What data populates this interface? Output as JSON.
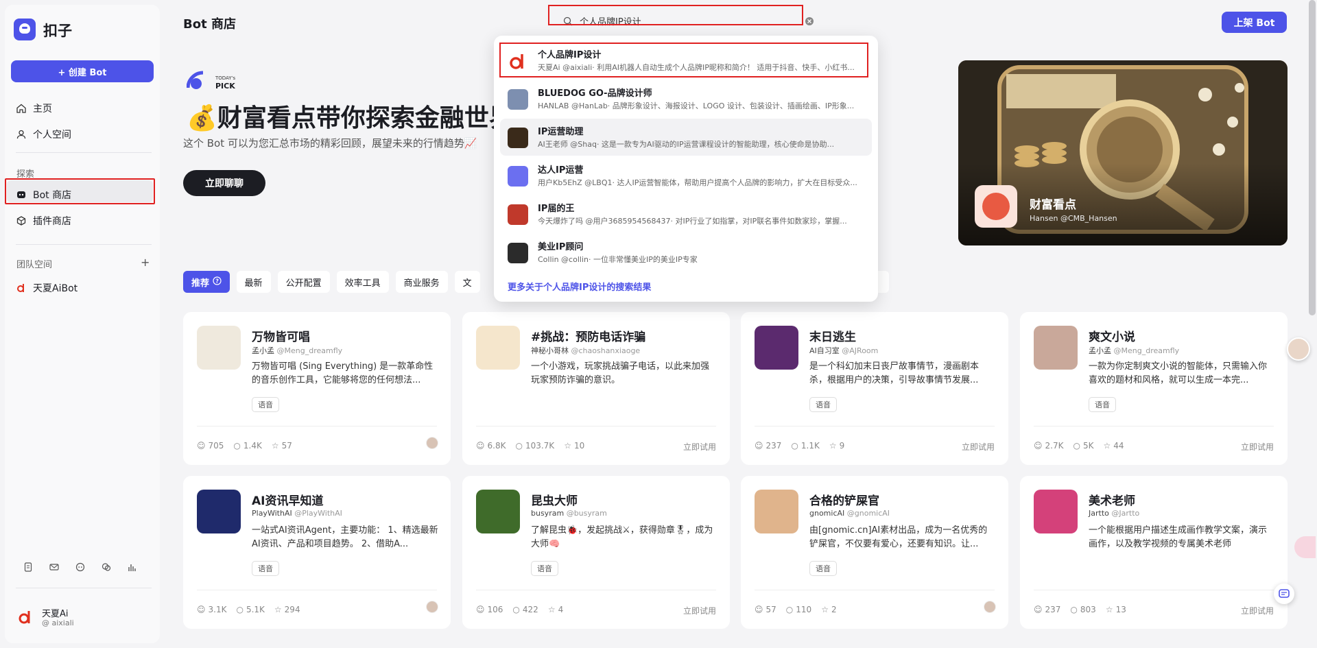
{
  "app": {
    "brand": "扣子"
  },
  "sidebar": {
    "create_label": "+ 创建 Bot",
    "items": [
      {
        "label": "主页",
        "icon": "home-icon"
      },
      {
        "label": "个人空间",
        "icon": "user-icon"
      }
    ],
    "explore_title": "探索",
    "explore_items": [
      {
        "label": "Bot 商店",
        "icon": "bot-store-icon",
        "active": true
      },
      {
        "label": "插件商店",
        "icon": "plugin-icon"
      }
    ],
    "team_title": "团队空间",
    "team_items": [
      {
        "label": "天夏AiBot"
      }
    ],
    "user": {
      "name": "天夏Ai",
      "handle": "@ aixiali"
    }
  },
  "header": {
    "title": "Bot 商店",
    "upload_label": "上架 Bot"
  },
  "search": {
    "value": "个人品牌IP设计"
  },
  "dropdown": {
    "items": [
      {
        "name": "个人品牌IP设计",
        "desc": "天夏Ai @aixiali· 利用AI机器人自动生成个人品牌IP昵称和简介！ 适用于抖音、快手、小红书...",
        "color": "#ffffff"
      },
      {
        "name": "BLUEDOG GO-品牌设计师",
        "desc": "HANLAB @HanLab· 品牌形象设计、海报设计、LOGO 设计、包装设计、插画绘画、IP形象...",
        "color": "#7d8fb0"
      },
      {
        "name": "IP运营助理",
        "desc": "AI王老师 @Shaq· 这是一款专为AI驱动的IP运营课程设计的智能助理，核心使命是协助...",
        "color": "#3a2a1a"
      },
      {
        "name": "达人IP运营",
        "desc": "用户Kb5EhZ @LBQ1· 达人IP运营智能体，帮助用户提高个人品牌的影响力，扩大在目标受众...",
        "color": "#6b6ff0"
      },
      {
        "name": "IP届的王",
        "desc": "今天爆炸了吗 @用户3685954568437· 对IP行业了如指掌，对IP联名事件如数家珍，掌握...",
        "color": "#c0392b"
      },
      {
        "name": "美业IP顾问",
        "desc": "Collin @collin· 一位非常懂美业IP的美业IP专家",
        "color": "#2b2b2b"
      }
    ],
    "more": "更多关于个人品牌IP设计的搜索结果"
  },
  "hero": {
    "pick": "TODAY'S PICK",
    "title": "💰财富看点带你探索金融世界",
    "desc": "这个 Bot 可以为您汇总市场的精彩回顾，展望未来的行情趋势📈",
    "button": "立即聊聊",
    "card_name": "财富看点",
    "card_author": "Hansen @CMB_Hansen"
  },
  "tabs": [
    "推荐",
    "最新",
    "公开配置",
    "效率工具",
    "商业服务",
    "文"
  ],
  "cards": [
    {
      "title": "万物皆可唱",
      "author": "孟小孟",
      "handle": "@Meng_dreamfly",
      "desc": "万物皆可唱 (Sing Everything) 是一款革命性的音乐创作工具，它能够将您的任何想法...",
      "tag": "语音",
      "users": "705",
      "chats": "1.4K",
      "stars": "57",
      "try": "",
      "thumb": "#efe9dd"
    },
    {
      "title": "#挑战：预防电话诈骗",
      "author": "神秘小哥林",
      "handle": "@chaoshanxiaoge",
      "desc": "一个小游戏，玩家挑战骗子电话，以此来加强玩家预防诈骗的意识。",
      "tag": "",
      "users": "6.8K",
      "chats": "103.7K",
      "stars": "10",
      "try": "立即试用",
      "thumb": "#f5e6cc"
    },
    {
      "title": "末日逃生",
      "author": "AI自习室",
      "handle": "@AJRoom",
      "desc": "是一个科幻加末日丧尸故事情节，漫画剧本杀，根据用户的决策，引导故事情节发展...",
      "tag": "语音",
      "users": "237",
      "chats": "1.1K",
      "stars": "9",
      "try": "立即试用",
      "thumb": "#5b2a6e"
    },
    {
      "title": "爽文小说",
      "author": "孟小孟",
      "handle": "@Meng_dreamfly",
      "desc": "一款为你定制爽文小说的智能体，只需输入你喜欢的题材和风格，就可以生成一本完...",
      "tag": "语音",
      "users": "2.7K",
      "chats": "5K",
      "stars": "44",
      "try": "立即试用",
      "thumb": "#c9a89a"
    },
    {
      "title": "AI资讯早知道",
      "author": "PlayWithAI",
      "handle": "@PlayWithAI",
      "desc": "一站式AI资讯Agent，主要功能： 1、精选最新AI资讯、产品和项目趋势。 2、借助A...",
      "tag": "语音",
      "users": "3.1K",
      "chats": "5.1K",
      "stars": "294",
      "try": "",
      "thumb": "#1f2a6b"
    },
    {
      "title": "昆虫大师",
      "author": "busyram",
      "handle": "@busyram",
      "desc": "了解昆虫🐞，发起挑战⚔，获得勋章🎖，成为大师🧠",
      "tag": "语音",
      "users": "106",
      "chats": "422",
      "stars": "4",
      "try": "立即试用",
      "thumb": "#3f6b2a"
    },
    {
      "title": "合格的铲屎官",
      "author": "gnomicAI",
      "handle": "@gnomicAI",
      "desc": "由[gnomic.cn]AI素材出品，成为一名优秀的铲屎官，不仅要有爱心，还要有知识。让...",
      "tag": "语音",
      "users": "57",
      "chats": "110",
      "stars": "2",
      "try": "",
      "thumb": "#e0b48c"
    },
    {
      "title": "美术老师",
      "author": "Jartto",
      "handle": "@Jartto",
      "desc": "一个能根据用户描述生成画作教学文案，演示画作，以及教学视频的专属美术老师",
      "tag": "",
      "users": "237",
      "chats": "803",
      "stars": "13",
      "try": "立即试用",
      "thumb": "#d4417a"
    }
  ]
}
